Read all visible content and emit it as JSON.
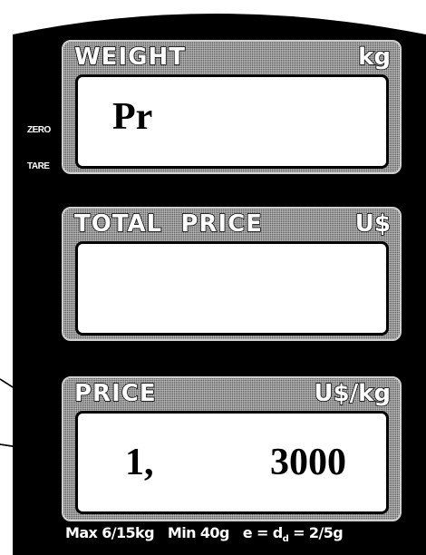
{
  "panels": {
    "weight": {
      "title": "WEIGHT",
      "unit": "kg",
      "display": "Pr"
    },
    "total_price": {
      "title": "TOTAL  PRICE",
      "unit": "U$",
      "display": ""
    },
    "price": {
      "title": "PRICE",
      "unit": "U$/kg",
      "display_left": "1,",
      "display_right": "3000"
    }
  },
  "indicators": {
    "zero": "ZERO",
    "tare": "TARE"
  },
  "spec": {
    "max": "Max 6/15kg",
    "min": "Min 40g",
    "e_prefix": "e = d",
    "d_sub": "d",
    "e_suffix": "= 2/5g"
  },
  "colors": {
    "body": "#000000",
    "panel": "#9a9a9a",
    "screen": "#ffffff"
  }
}
